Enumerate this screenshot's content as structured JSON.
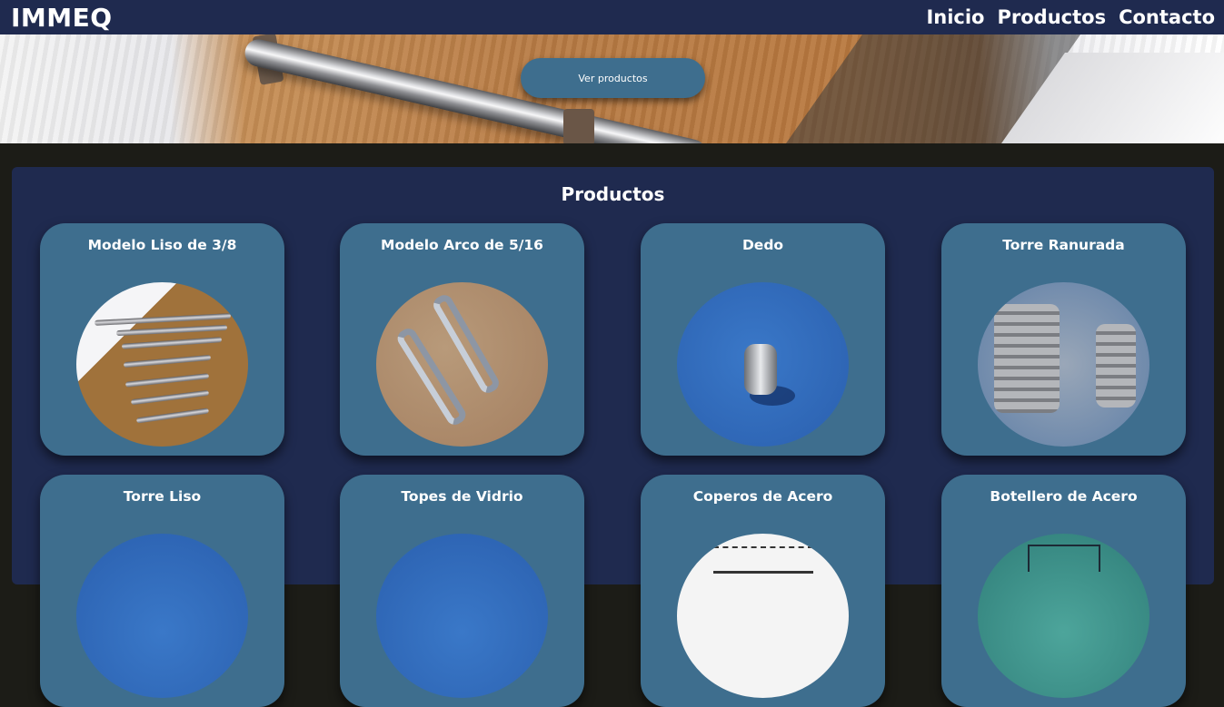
{
  "header": {
    "brand": "IMMEQ",
    "nav": [
      "Inicio",
      "Productos",
      "Contacto"
    ]
  },
  "hero": {
    "button_label": "Ver productos"
  },
  "products": {
    "title": "Productos",
    "items": [
      {
        "name": "Modelo Liso de 3/8"
      },
      {
        "name": "Modelo Arco de 5/16"
      },
      {
        "name": "Dedo"
      },
      {
        "name": "Torre Ranurada"
      },
      {
        "name": "Torre Liso"
      },
      {
        "name": "Topes de Vidrio"
      },
      {
        "name": "Coperos de Acero"
      },
      {
        "name": "Botellero de Acero"
      }
    ]
  },
  "colors": {
    "header_bg": "#1f2a4f",
    "card_bg": "#3e6e8e",
    "button_bg": "#3e6e8e",
    "page_bg": "#1c1c17"
  }
}
